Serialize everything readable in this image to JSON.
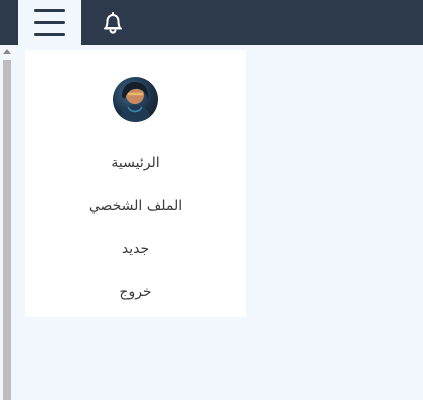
{
  "header": {
    "menu_icon": "hamburger-menu-icon",
    "notification_icon": "bell-icon",
    "background": "#2d3a4c"
  },
  "sidebar": {
    "avatar_alt": "user-avatar",
    "items": [
      {
        "label": "الرئيسية"
      },
      {
        "label": "الملف الشخصي"
      },
      {
        "label": "جديد"
      },
      {
        "label": "خروج"
      }
    ]
  },
  "colors": {
    "page_background": "#f2f6fd",
    "card_background": "#ffffff",
    "text": "#3b3b3b"
  }
}
